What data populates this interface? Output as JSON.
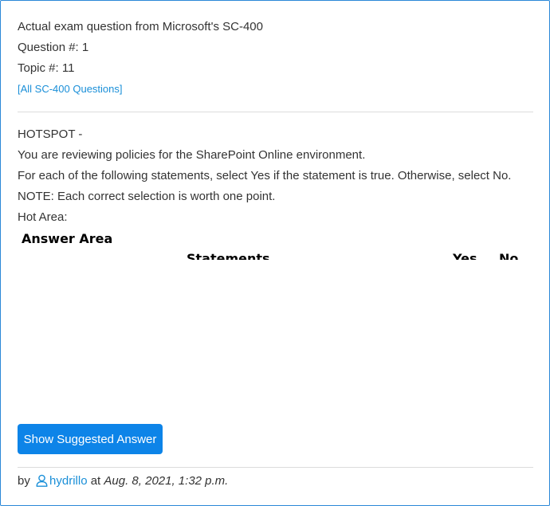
{
  "header": {
    "title": "Actual exam question from Microsoft's SC-400",
    "question_number": "Question #: 1",
    "topic": "Topic #: 11",
    "all_questions_link": "[All SC-400 Questions]"
  },
  "question": {
    "lines": [
      "HOTSPOT -",
      "You are reviewing policies for the SharePoint Online environment.",
      "For each of the following statements, select Yes if the statement is true. Otherwise, select No.",
      "NOTE: Each correct selection is worth one point.",
      "Hot Area:"
    ]
  },
  "answer_area": {
    "title": "Answer Area",
    "statements_label": "Statements",
    "yes_label": "Yes",
    "no_label": "No"
  },
  "actions": {
    "show_answer_label": "Show Suggested Answer"
  },
  "footer": {
    "by": "by",
    "user_icon": "user-icon",
    "username": "hydrillo",
    "at": "at",
    "date": "Aug. 8, 2021, 1:32 p.m."
  }
}
